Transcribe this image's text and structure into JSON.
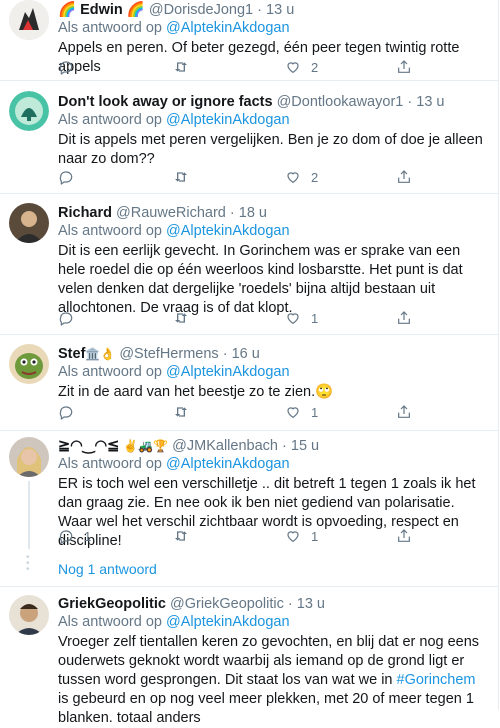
{
  "reply_prefix": "Als antwoord op",
  "reply_target": "@AlptekinAkdogan",
  "dot": "·",
  "tweets": [
    {
      "name": "Edwin",
      "emoji_before": "🌈",
      "emoji_after": "🌈",
      "handle": "@DorisdeJong1",
      "time": "13 u",
      "text": "Appels en peren. Of beter gezegd, één peer tegen twintig rotte appels",
      "reply_count": "",
      "retweet_count": "",
      "like_count": "2"
    },
    {
      "name": "Don't look away or ignore facts",
      "handle": "@Dontlookawayor1",
      "time": "13 u",
      "text": "Dit is appels met peren vergelijken. Ben je zo dom of doe je alleen naar zo dom??",
      "reply_count": "",
      "retweet_count": "",
      "like_count": "2"
    },
    {
      "name": "Richard",
      "handle": "@RauweRichard",
      "time": "18 u",
      "text": "Dit is een eerlijk gevecht. In Gorinchem was er sprake van een hele roedel die op één weerloos kind losbarstte. Het punt is dat velen denken dat dergelijke 'roedels' bijna altijd bestaan uit allochtonen. De vraag is of dat klopt.",
      "reply_count": "",
      "retweet_count": "",
      "like_count": "1"
    },
    {
      "name": "Stef",
      "emoji_after": "🏛️👌",
      "handle": "@StefHermens",
      "time": "16 u",
      "text": "Zit in de aard van het beestje zo te zien.",
      "text_emoji": "🙄",
      "reply_count": "",
      "retweet_count": "",
      "like_count": "1"
    },
    {
      "name": "≧◠‿◠≦",
      "emoji_after": "✌🚜🏆",
      "handle": "@JMKallenbach",
      "time": "15 u",
      "text": "ER is toch wel een verschilletje .. dit betreft 1 tegen 1 zoals ik het dan graag zie. En nee ook ik ben niet gediend van polarisatie. Waar wel het verschil zichtbaar wordt is opvoeding, respect en discipline!",
      "reply_count": "1",
      "retweet_count": "",
      "like_count": "1"
    },
    {
      "name": "GriekGeopolitic",
      "handle": "@GriekGeopolitic",
      "time": "13 u",
      "text_before": "Vroeger zelf tientallen keren zo gevochten, en blij dat er nog eens ouderwets geknokt wordt waarbij als iemand op de grond ligt er tussen word gesprongen. Dit staat los van wat we in ",
      "hashtag": "#Gorinchem",
      "text_after": " is gebeurd en op nog veel meer plekken, met 20 of meer tegen 1 blanken. totaal anders"
    }
  ],
  "more_replies_label": "Nog 1 antwoord",
  "icons": {
    "reply": "reply-icon",
    "retweet": "retweet-icon",
    "like": "heart-icon",
    "share": "share-icon"
  }
}
